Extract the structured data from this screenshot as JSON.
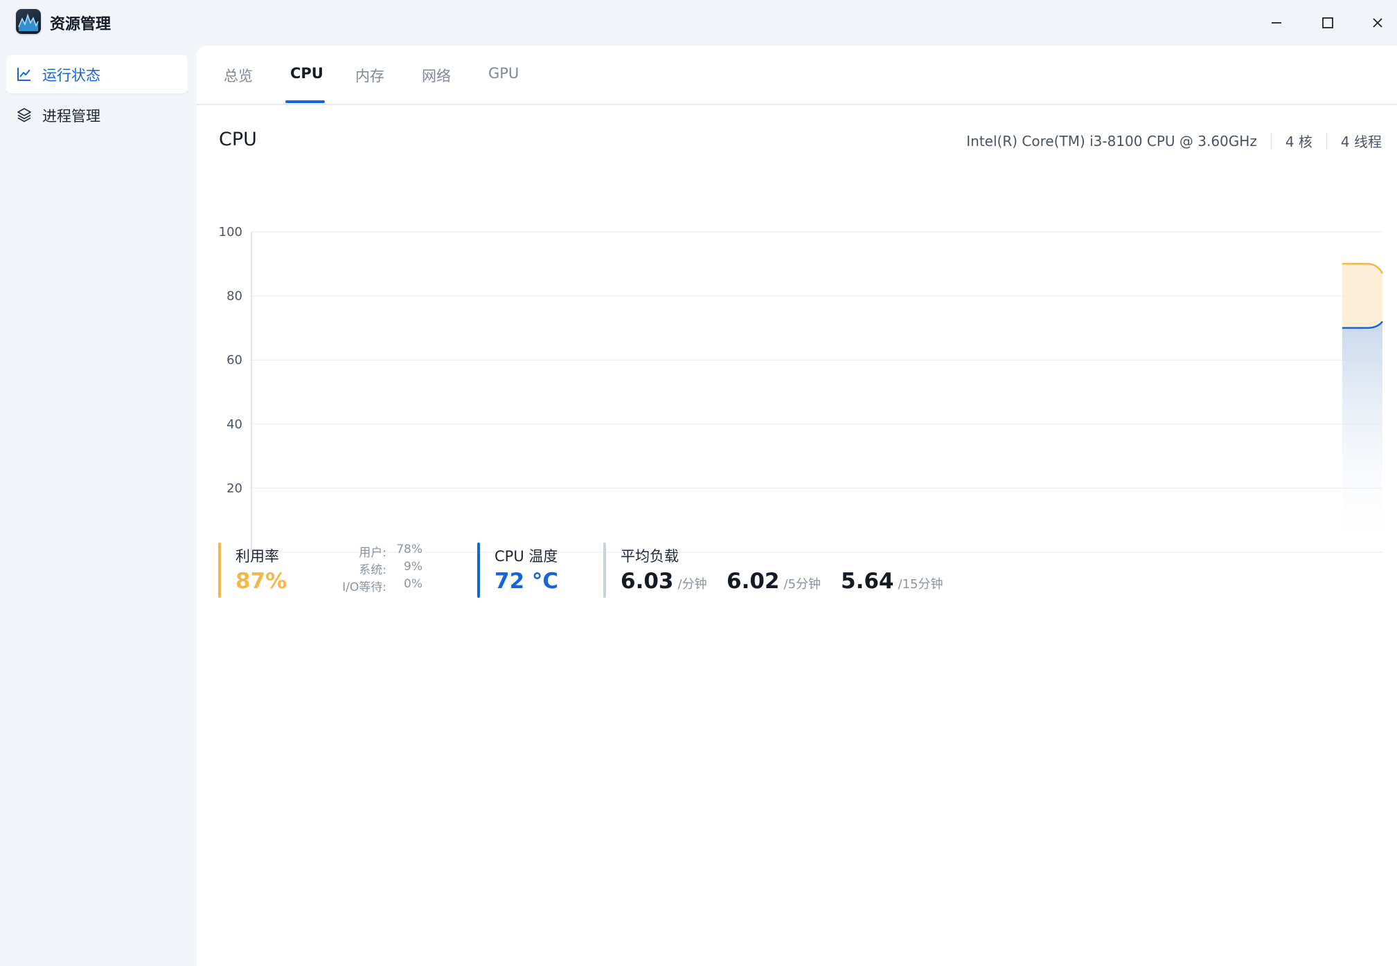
{
  "app": {
    "title": "资源管理"
  },
  "window_controls": {
    "minimize": "minimize-icon",
    "maximize": "maximize-icon",
    "close": "close-icon"
  },
  "sidebar": {
    "items": [
      {
        "label": "运行状态",
        "icon": "line-chart-icon",
        "active": true
      },
      {
        "label": "进程管理",
        "icon": "layers-icon",
        "active": false
      }
    ]
  },
  "tabs": [
    {
      "label": "总览",
      "active": false
    },
    {
      "label": "CPU",
      "active": true
    },
    {
      "label": "内存",
      "active": false
    },
    {
      "label": "网络",
      "active": false
    },
    {
      "label": "GPU",
      "active": false
    }
  ],
  "section": {
    "title": "CPU",
    "model": "Intel(R) Core(TM) i3-8100 CPU @ 3.60GHz",
    "cores": "4 核",
    "threads": "4 线程"
  },
  "colors": {
    "accent": "#1565d8",
    "usage": "#f2b84b",
    "usage_fill": "#fdefd7",
    "user_fill": "#c9d8ec",
    "text": "#1f2633"
  },
  "chart_data": {
    "type": "area",
    "ylim": [
      0,
      100
    ],
    "yticks": [
      20,
      40,
      60,
      80,
      100
    ],
    "grid": true,
    "series": [
      {
        "values": [
          90,
          90,
          87
        ]
      },
      {
        "values": [
          70,
          70,
          72
        ]
      }
    ]
  },
  "stats": {
    "usage": {
      "label": "利用率",
      "value": "87%",
      "details": [
        {
          "key": "用户:",
          "value": "78%"
        },
        {
          "key": "系统:",
          "value": "9%"
        },
        {
          "key": "I/O等待:",
          "value": "0%"
        }
      ]
    },
    "temperature": {
      "label": "CPU 温度",
      "value": "72 °C"
    },
    "load": {
      "label": "平均负载",
      "values": [
        {
          "value": "6.03",
          "unit": "/分钟"
        },
        {
          "value": "6.02",
          "unit": "/5分钟"
        },
        {
          "value": "5.64",
          "unit": "/15分钟"
        }
      ]
    }
  }
}
